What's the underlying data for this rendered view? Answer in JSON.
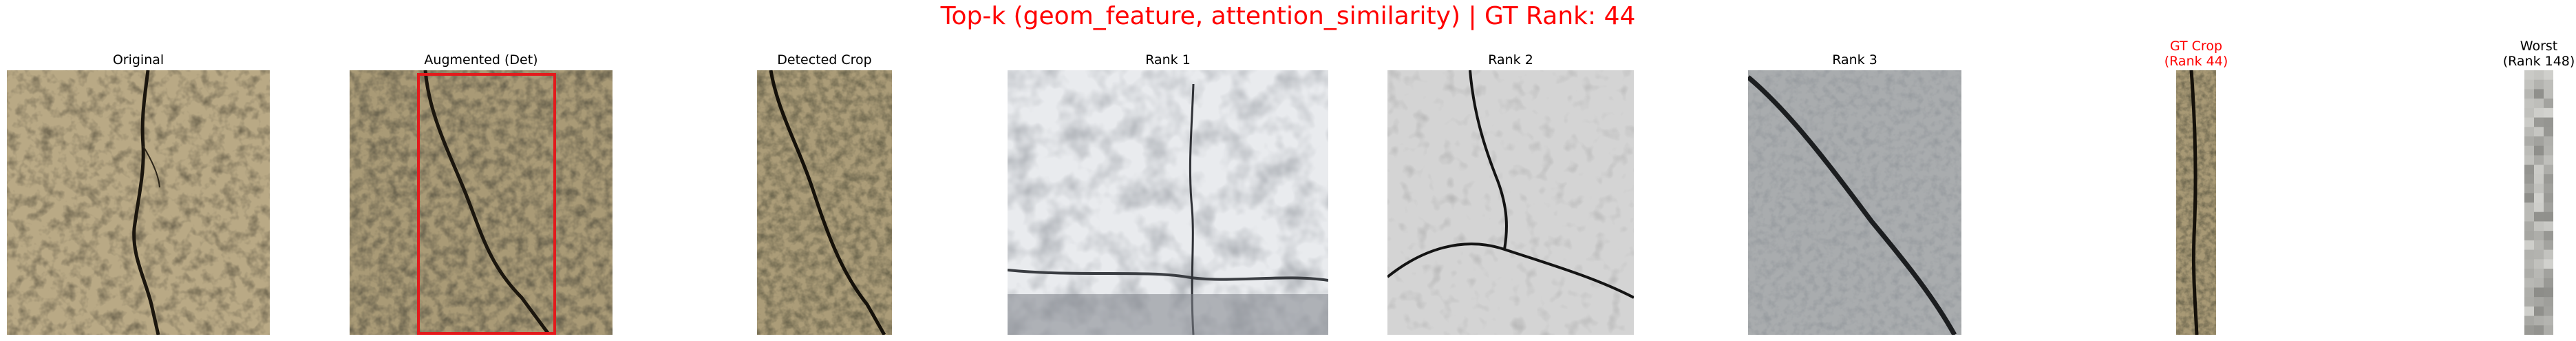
{
  "figure": {
    "title": "Top-k (geom_feature, attention_similarity) | GT Rank: 44",
    "title_color": "#ff0000"
  },
  "panels": [
    {
      "id": "original",
      "title": [
        "Original"
      ],
      "title_color": "#000000",
      "image": "cracked-concrete-photo"
    },
    {
      "id": "augmented",
      "title": [
        "Augmented (Det)"
      ],
      "title_color": "#000000",
      "image": "cracked-concrete-photo-with-detection-box",
      "box_color": "#e31a1c"
    },
    {
      "id": "detected",
      "title": [
        "Detected Crop"
      ],
      "title_color": "#000000",
      "image": "cropped-crack-photo"
    },
    {
      "id": "rank1",
      "title": [
        "Rank 1"
      ],
      "title_color": "#000000",
      "image": "white-painted-crack-photo"
    },
    {
      "id": "rank2",
      "title": [
        "Rank 2"
      ],
      "title_color": "#000000",
      "image": "grey-plaster-crack-photo"
    },
    {
      "id": "rank3",
      "title": [
        "Rank 3"
      ],
      "title_color": "#000000",
      "image": "grey-stone-crack-photo"
    },
    {
      "id": "gtcrop",
      "title": [
        "GT Crop",
        "(Rank 44)"
      ],
      "title_color": "#ff0000",
      "image": "narrow-crack-strip"
    },
    {
      "id": "worst",
      "title": [
        "Worst",
        "(Rank 148)"
      ],
      "title_color": "#000000",
      "image": "pixelated-grey-strip"
    }
  ]
}
